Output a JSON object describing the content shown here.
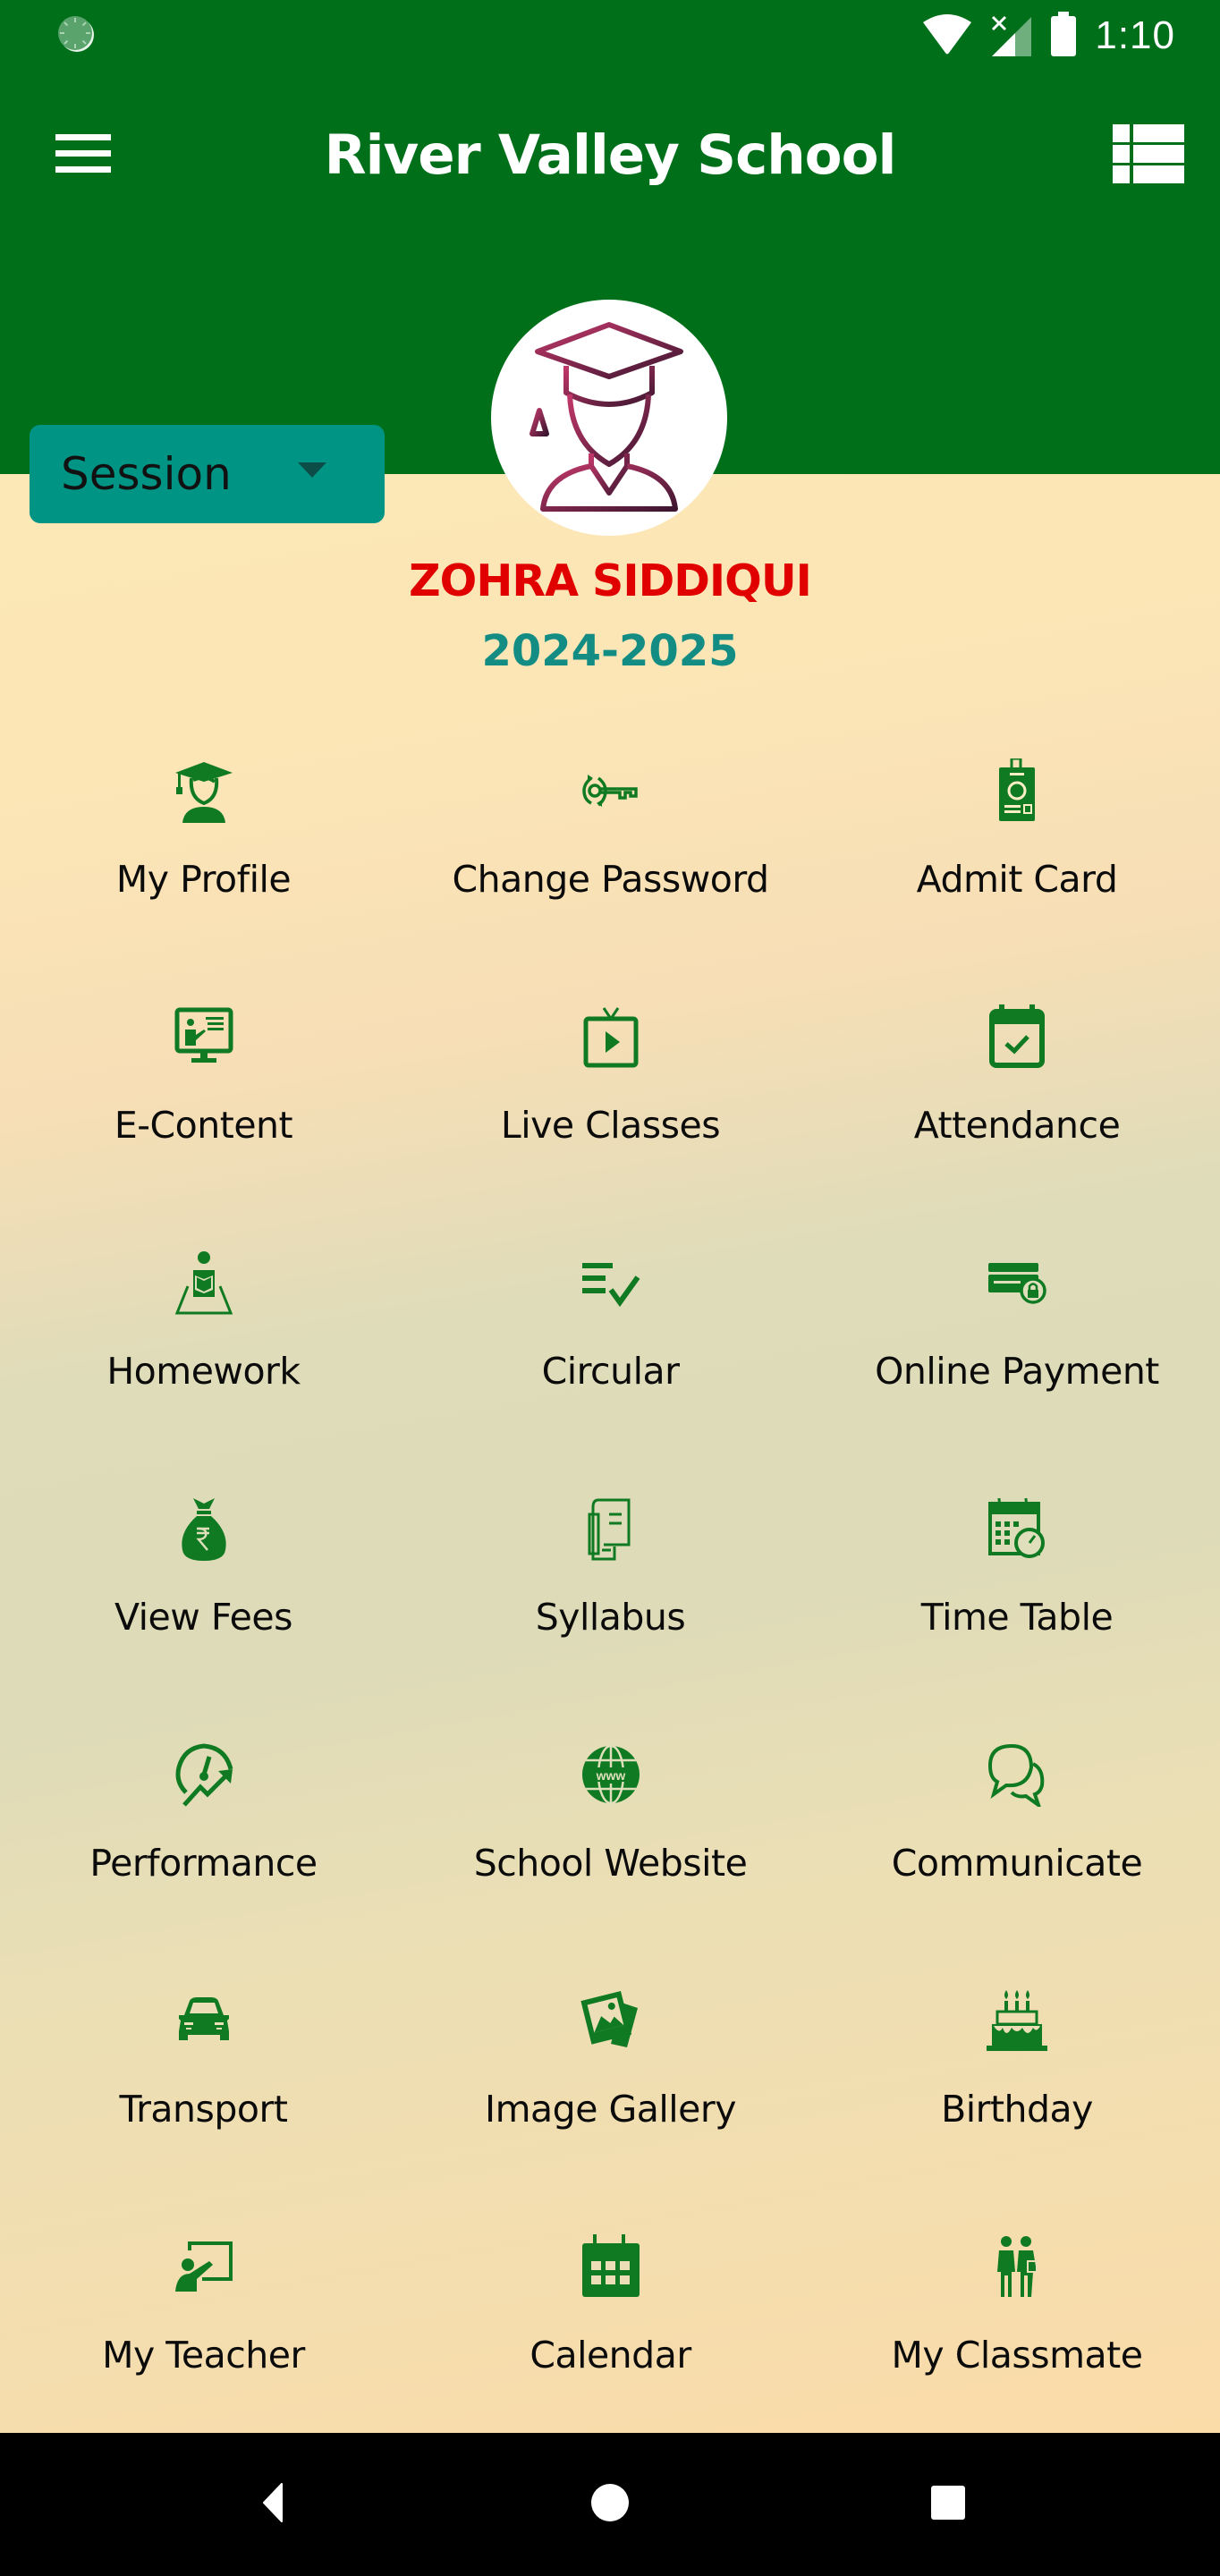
{
  "status_bar": {
    "time": "1:10",
    "icons": [
      "app-notification-icon",
      "wifi-icon",
      "no-signal-icon",
      "battery-icon"
    ]
  },
  "toolbar": {
    "title": "River Valley School",
    "menu_icon": "hamburger-menu-icon",
    "view_icon": "list-view-icon"
  },
  "profile": {
    "session_label": "Session",
    "avatar_icon": "graduate-student-icon",
    "name": "ZOHRA SIDDIQUI",
    "session_year": "2024-2025"
  },
  "colors": {
    "header_green": "#006f1a",
    "icon_green": "#0f7a22",
    "session_teal": "#009485",
    "name_red": "#e00000",
    "year_teal": "#138d84"
  },
  "menu": [
    {
      "label": "My Profile",
      "icon": "graduate-profile-icon"
    },
    {
      "label": "Change Password",
      "icon": "key-refresh-icon"
    },
    {
      "label": "Admit Card",
      "icon": "id-card-icon"
    },
    {
      "label": "E-Content",
      "icon": "monitor-teacher-icon"
    },
    {
      "label": "Live Classes",
      "icon": "tv-play-icon"
    },
    {
      "label": "Attendance",
      "icon": "calendar-check-icon"
    },
    {
      "label": "Homework",
      "icon": "student-reading-icon"
    },
    {
      "label": "Circular",
      "icon": "list-check-icon"
    },
    {
      "label": "Online Payment",
      "icon": "credit-card-lock-icon"
    },
    {
      "label": "View Fees",
      "icon": "rupee-bag-icon"
    },
    {
      "label": "Syllabus",
      "icon": "scroll-book-icon"
    },
    {
      "label": "Time Table",
      "icon": "calendar-clock-icon"
    },
    {
      "label": "Performance",
      "icon": "speedometer-growth-icon"
    },
    {
      "label": "School Website",
      "icon": "globe-www-icon"
    },
    {
      "label": "Communicate",
      "icon": "chat-bubbles-icon"
    },
    {
      "label": "Transport",
      "icon": "car-icon"
    },
    {
      "label": "Image Gallery",
      "icon": "photo-stack-icon"
    },
    {
      "label": "Birthday",
      "icon": "birthday-cake-icon"
    },
    {
      "label": "My Teacher",
      "icon": "teacher-board-icon"
    },
    {
      "label": "Calendar",
      "icon": "calendar-icon"
    },
    {
      "label": "My Classmate",
      "icon": "two-people-icon"
    }
  ],
  "nav_bar": {
    "buttons": [
      "back-icon",
      "home-icon",
      "recents-icon"
    ]
  }
}
